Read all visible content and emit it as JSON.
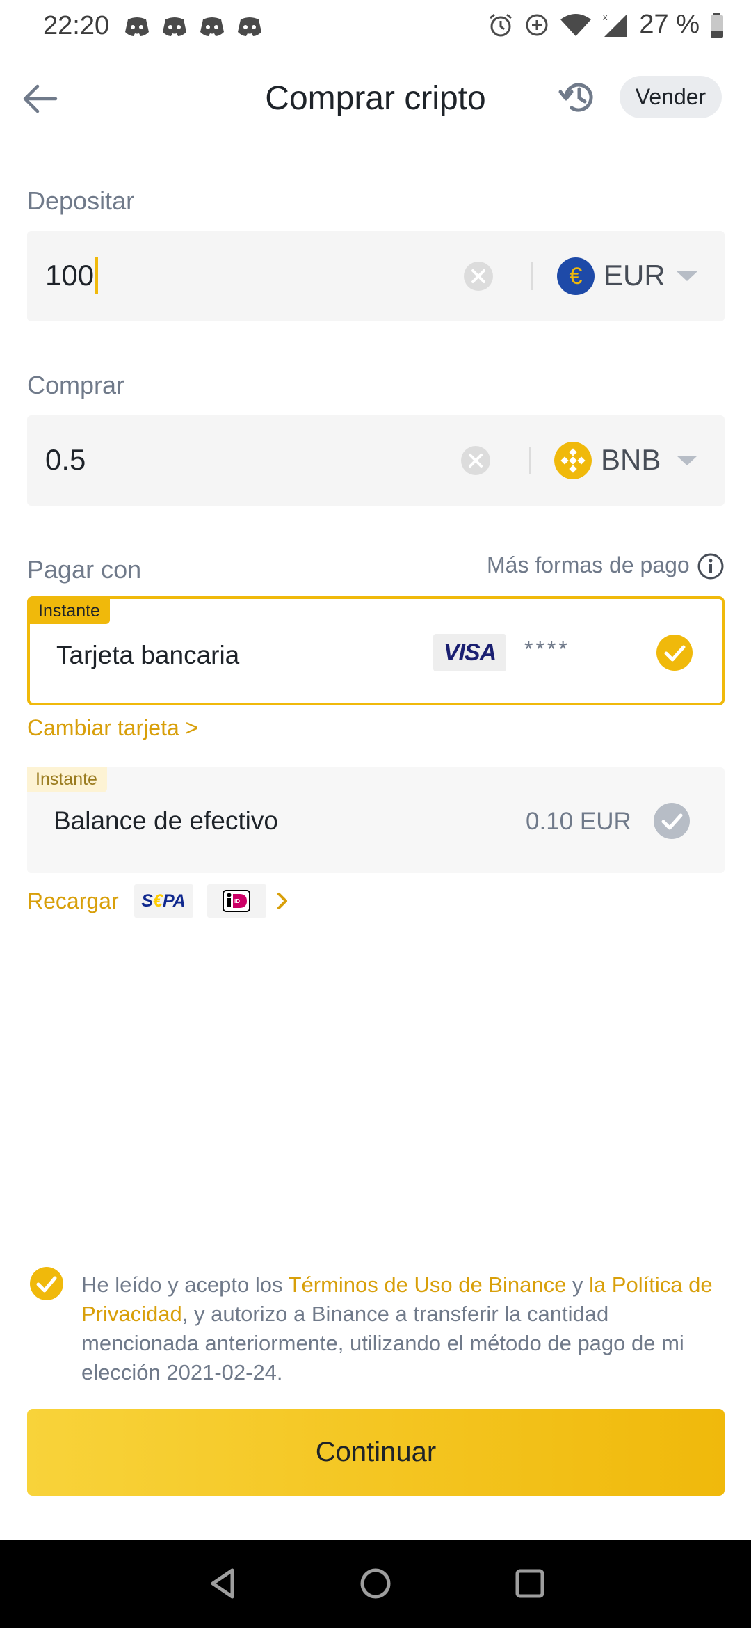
{
  "status_bar": {
    "time": "22:20",
    "battery": "27 %"
  },
  "header": {
    "title": "Comprar cripto",
    "sell_label": "Vender"
  },
  "deposit": {
    "label": "Depositar",
    "value": "100",
    "currency": "EUR",
    "currency_symbol": "€"
  },
  "buy": {
    "label": "Comprar",
    "value": "0.5",
    "currency": "BNB"
  },
  "payment": {
    "label": "Pagar con",
    "more_methods": "Más formas de pago",
    "card_option": {
      "badge": "Instante",
      "title": "Tarjeta bancaria",
      "brand": "VISA",
      "masked_number": "****"
    },
    "change_card": "Cambiar tarjeta >",
    "cash_option": {
      "badge": "Instante",
      "title": "Balance de efectivo",
      "amount": "0.10 EUR"
    },
    "recharge": {
      "label": "Recargar",
      "sepa": "SEPA",
      "ideal": "iDEAL"
    }
  },
  "terms": {
    "part1": "He leído y acepto los ",
    "link1": "Términos de Uso de Binance",
    "part2": " y ",
    "link2": "la Política de Privacidad",
    "part3": ", y autorizo a Binance a transferir la cantidad mencionada anteriormente, utilizando el método de pago de mi elección 2021-02-24."
  },
  "continue_label": "Continuar",
  "colors": {
    "accent": "#f0b90b",
    "link": "#d89f0a",
    "text": "#1e2329",
    "muted": "#707a8a"
  }
}
